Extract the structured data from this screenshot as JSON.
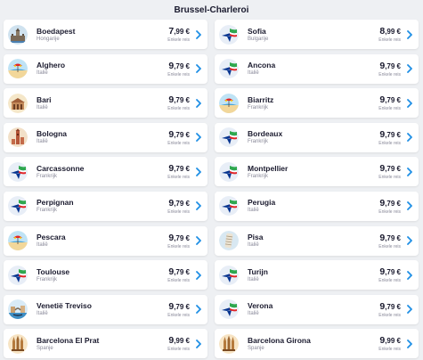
{
  "header": {
    "title": "Brussel-Charleroi"
  },
  "colors": {
    "accent": "#1f8fe5",
    "dark": "#1a1a2e",
    "muted": "#8a8a9a"
  },
  "destinations": [
    {
      "city": "Boedapest",
      "country": "Hongarije",
      "price_int": "7",
      "price_dec": ",99 €",
      "price_type": "Enkele reis",
      "icon": "parliament-icon"
    },
    {
      "city": "Sofia",
      "country": "Bulgarije",
      "price_int": "8",
      "price_dec": ",99 €",
      "price_type": "Enkele reis",
      "icon": "plane-flag-icon"
    },
    {
      "city": "Alghero",
      "country": "Italië",
      "price_int": "9",
      "price_dec": ",79 €",
      "price_type": "Enkele reis",
      "icon": "beach-icon"
    },
    {
      "city": "Ancona",
      "country": "Italië",
      "price_int": "9",
      "price_dec": ",79 €",
      "price_type": "Enkele reis",
      "icon": "plane-flag-icon"
    },
    {
      "city": "Bari",
      "country": "Italië",
      "price_int": "9",
      "price_dec": ",79 €",
      "price_type": "Enkele reis",
      "icon": "landmark-icon"
    },
    {
      "city": "Biarritz",
      "country": "Frankrijk",
      "price_int": "9",
      "price_dec": ",79 €",
      "price_type": "Enkele reis",
      "icon": "beach-icon"
    },
    {
      "city": "Bologna",
      "country": "Italië",
      "price_int": "9",
      "price_dec": ",79 €",
      "price_type": "Enkele reis",
      "icon": "tower-icon"
    },
    {
      "city": "Bordeaux",
      "country": "Frankrijk",
      "price_int": "9",
      "price_dec": ",79 €",
      "price_type": "Enkele reis",
      "icon": "plane-flag-icon"
    },
    {
      "city": "Carcassonne",
      "country": "Frankrijk",
      "price_int": "9",
      "price_dec": ",79 €",
      "price_type": "Enkele reis",
      "icon": "plane-flag-icon"
    },
    {
      "city": "Montpellier",
      "country": "Frankrijk",
      "price_int": "9",
      "price_dec": ",79 €",
      "price_type": "Enkele reis",
      "icon": "plane-flag-icon"
    },
    {
      "city": "Perpignan",
      "country": "Frankrijk",
      "price_int": "9",
      "price_dec": ",79 €",
      "price_type": "Enkele reis",
      "icon": "plane-flag-icon"
    },
    {
      "city": "Perugia",
      "country": "Italië",
      "price_int": "9",
      "price_dec": ",79 €",
      "price_type": "Enkele reis",
      "icon": "plane-flag-icon"
    },
    {
      "city": "Pescara",
      "country": "Italië",
      "price_int": "9",
      "price_dec": ",79 €",
      "price_type": "Enkele reis",
      "icon": "beach-icon"
    },
    {
      "city": "Pisa",
      "country": "Italië",
      "price_int": "9",
      "price_dec": ",79 €",
      "price_type": "Enkele reis",
      "icon": "leaning-tower-icon"
    },
    {
      "city": "Toulouse",
      "country": "Frankrijk",
      "price_int": "9",
      "price_dec": ",79 €",
      "price_type": "Enkele reis",
      "icon": "plane-flag-icon"
    },
    {
      "city": "Turijn",
      "country": "Italië",
      "price_int": "9",
      "price_dec": ",79 €",
      "price_type": "Enkele reis",
      "icon": "plane-flag-icon"
    },
    {
      "city": "Venetië Treviso",
      "country": "Italië",
      "price_int": "9",
      "price_dec": ",79 €",
      "price_type": "Enkele reis",
      "icon": "canal-icon"
    },
    {
      "city": "Verona",
      "country": "Italië",
      "price_int": "9",
      "price_dec": ",79 €",
      "price_type": "Enkele reis",
      "icon": "plane-flag-icon"
    },
    {
      "city": "Barcelona El Prat",
      "country": "Spanje",
      "price_int": "9",
      "price_dec": ",99 €",
      "price_type": "Enkele reis",
      "icon": "basilica-icon"
    },
    {
      "city": "Barcelona Girona",
      "country": "Spanje",
      "price_int": "9",
      "price_dec": ",99 €",
      "price_type": "Enkele reis",
      "icon": "basilica-icon"
    }
  ]
}
